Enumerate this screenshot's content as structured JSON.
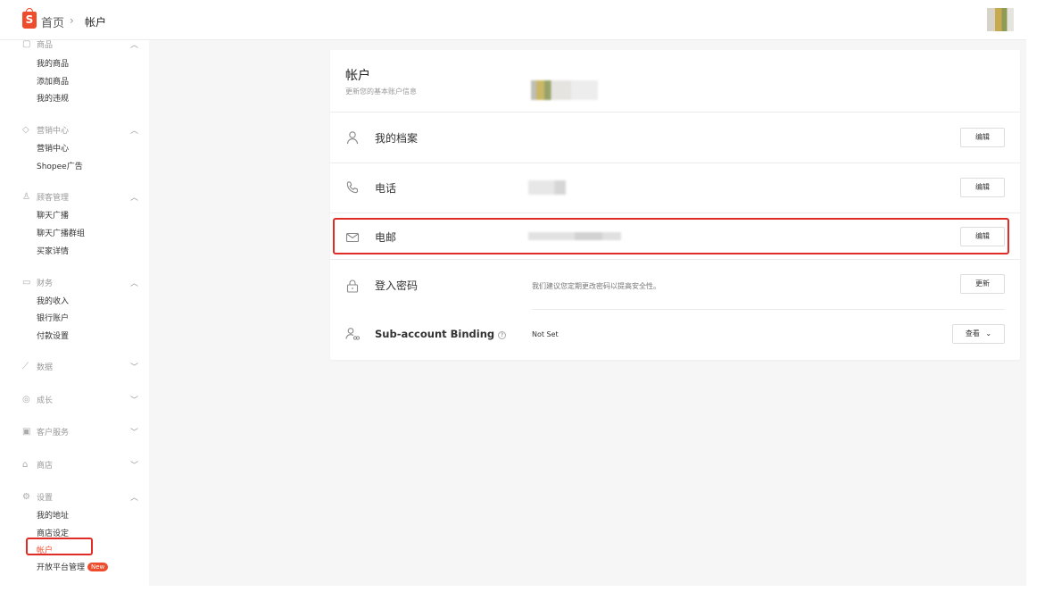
{
  "header": {
    "logo_letter": "S",
    "breadcrumb_home": "首页",
    "breadcrumb_separator": "›",
    "breadcrumb_current": "帐户"
  },
  "sidebar": {
    "sections": [
      {
        "label": "商品",
        "icon": "box-icon",
        "expanded": true,
        "items": [
          "我的商品",
          "添加商品",
          "我的违规"
        ]
      },
      {
        "label": "营销中心",
        "icon": "tag-icon",
        "expanded": true,
        "items": [
          "营销中心",
          "Shopee广告"
        ]
      },
      {
        "label": "顾客管理",
        "icon": "user-group-icon",
        "expanded": true,
        "items": [
          "聊天广播",
          "聊天广播群组",
          "买家详情"
        ]
      },
      {
        "label": "财务",
        "icon": "wallet-icon",
        "expanded": true,
        "items": [
          "我的收入",
          "银行账户",
          "付款设置"
        ]
      },
      {
        "label": "数据",
        "icon": "chart-icon",
        "expanded": false,
        "items": []
      },
      {
        "label": "成长",
        "icon": "growth-icon",
        "expanded": false,
        "items": []
      },
      {
        "label": "客户服务",
        "icon": "chat-icon",
        "expanded": false,
        "items": []
      },
      {
        "label": "商店",
        "icon": "store-icon",
        "expanded": false,
        "items": []
      },
      {
        "label": "设置",
        "icon": "gear-icon",
        "expanded": true,
        "items": [
          "我的地址",
          "商店设定",
          "帐户",
          "开放平台管理"
        ]
      }
    ],
    "active_item": "帐户",
    "new_badge": "New"
  },
  "account_card": {
    "title": "帐户",
    "subtitle": "更新您的基本账户信息",
    "rows": [
      {
        "label": "我的档案",
        "icon": "person-icon",
        "value": "",
        "button": "编辑"
      },
      {
        "label": "电话",
        "icon": "phone-icon",
        "value": "",
        "button": "编辑"
      },
      {
        "label": "电邮",
        "icon": "mail-icon",
        "value": "",
        "button": "编辑"
      },
      {
        "label": "登入密码",
        "icon": "lock-icon",
        "value": "我们建议您定期更改密码以提高安全性。",
        "button": "更新"
      },
      {
        "label": "Sub-account Binding",
        "icon": "sub-account-icon",
        "value": "Not Set",
        "button": "查看"
      }
    ]
  },
  "colors": {
    "accent": "#ee4d2d",
    "highlight_border": "#e02b27",
    "page_bg": "#f6f6f6"
  }
}
